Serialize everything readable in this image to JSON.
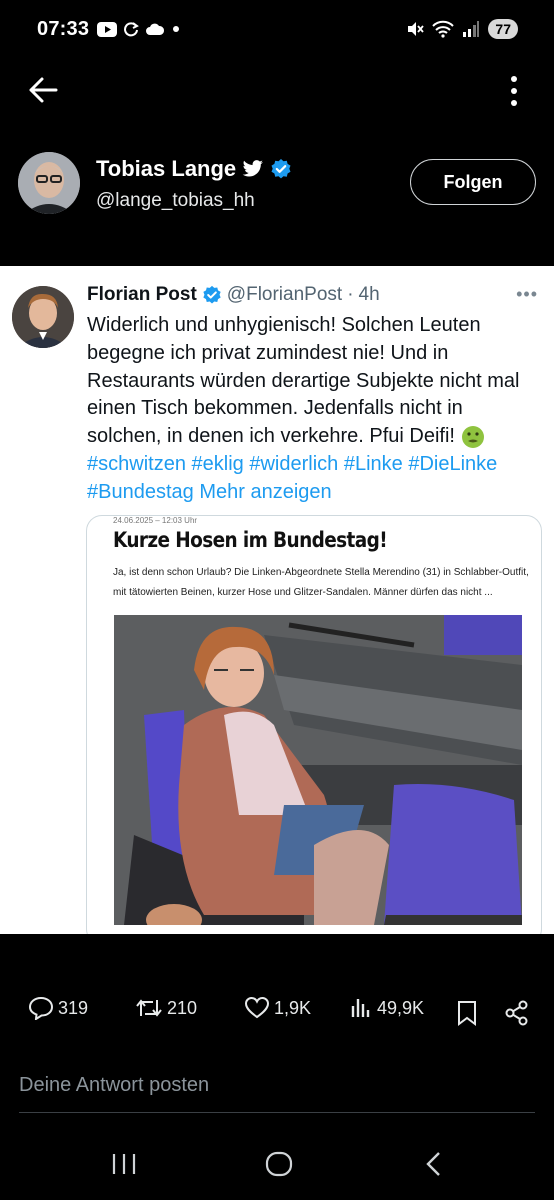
{
  "status_bar": {
    "time": "07:33",
    "battery": "77",
    "icons": [
      "youtube-icon",
      "sync-icon",
      "cloud-icon",
      "dot-icon",
      "mute-icon",
      "wifi-icon",
      "signal-icon"
    ]
  },
  "profile": {
    "name": "Tobias Lange",
    "handle": "@lange_tobias_hh",
    "follow_label": "Folgen"
  },
  "tweet": {
    "author": "Florian Post",
    "handle": "@FlorianPost",
    "separator": "·",
    "time": "4h",
    "text": "Widerlich und unhygienisch! Solchen Leuten begegne ich privat zumindest nie! Und in Restaurants würden derartige Subjekte nicht mal einen Tisch bekommen. Jedenfalls nicht in solchen, in denen ich verkehre. Pfui Deifi!",
    "hashtags": [
      "#schwitzen",
      "#eklig",
      "#widerlich",
      "#Linke",
      "#DieLinke",
      "#Bundestag"
    ],
    "more_label": "Mehr anzeigen",
    "embedded_article": {
      "date": "24.06.2025 – 12:03 Uhr",
      "title": "Kurze Hosen im Bundestag!",
      "lede": "Ja, ist denn schon Urlaub? Die Linken-Abgeordnete Stella Merendino (31) in Schlabber-Outfit, mit tätowierten Beinen, kurzer Hose und Glitzer-Sandalen. Männer dürfen das nicht ..."
    }
  },
  "actions": {
    "replies": "319",
    "reposts": "210",
    "likes": "1,9K",
    "views": "49,9K"
  },
  "reply": {
    "placeholder": "Deine Antwort posten"
  },
  "colors": {
    "accent": "#1d9bf0",
    "background": "#000000",
    "card": "#ffffff"
  }
}
